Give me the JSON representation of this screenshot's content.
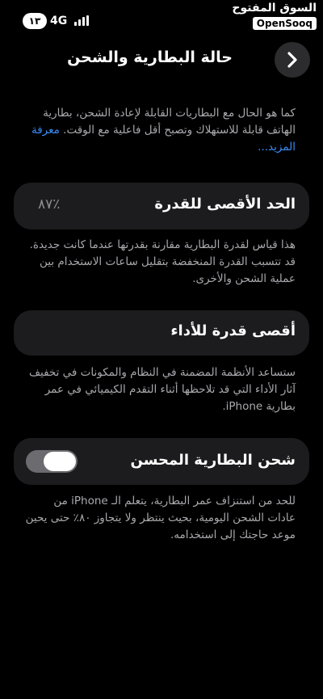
{
  "status_bar": {
    "time": "١٣",
    "network": "4G"
  },
  "watermark": {
    "arabic": "السوق المفتوح",
    "english": "OpenSooq"
  },
  "header": {
    "title": "حالة البطارية والشحن",
    "back_icon": "chevron-right-icon"
  },
  "intro": {
    "text": "كما هو الحال مع البطاريات القابلة لإعادة الشحن، بطارية الهاتف قابلة للاستهلاك وتصبح أقل فاعلية مع الوقت.",
    "link": "معرفة المزيد..."
  },
  "maximum_capacity": {
    "label": "الحد الأقصى للقدرة",
    "value": "٪٨٧",
    "description": "هذا قياس لقدرة البطارية مقارنة بقدرتها عندما كانت جديدة. قد تتسبب القدرة المنخفضة بتقليل ساعات الاستخدام بين عملية الشحن والأخرى."
  },
  "peak_performance": {
    "label": "أقصى قدرة للأداء",
    "description": "ستساعد الأنظمة المضمنة في النظام والمكونات في تخفيف آثار الأداء التي قد تلاحظها أثناء التقدم الكيميائي في عمر بطارية iPhone."
  },
  "optimized_charging": {
    "label": "شحن البطارية المحسن",
    "enabled": true,
    "description": "للحد من استنزاف عمر البطارية، يتعلم الـ iPhone من عادات الشحن اليومية، بحيث ينتظر ولا يتجاوز ٨٠٪ حتى يحين موعد حاجتك إلى استخدامه."
  }
}
